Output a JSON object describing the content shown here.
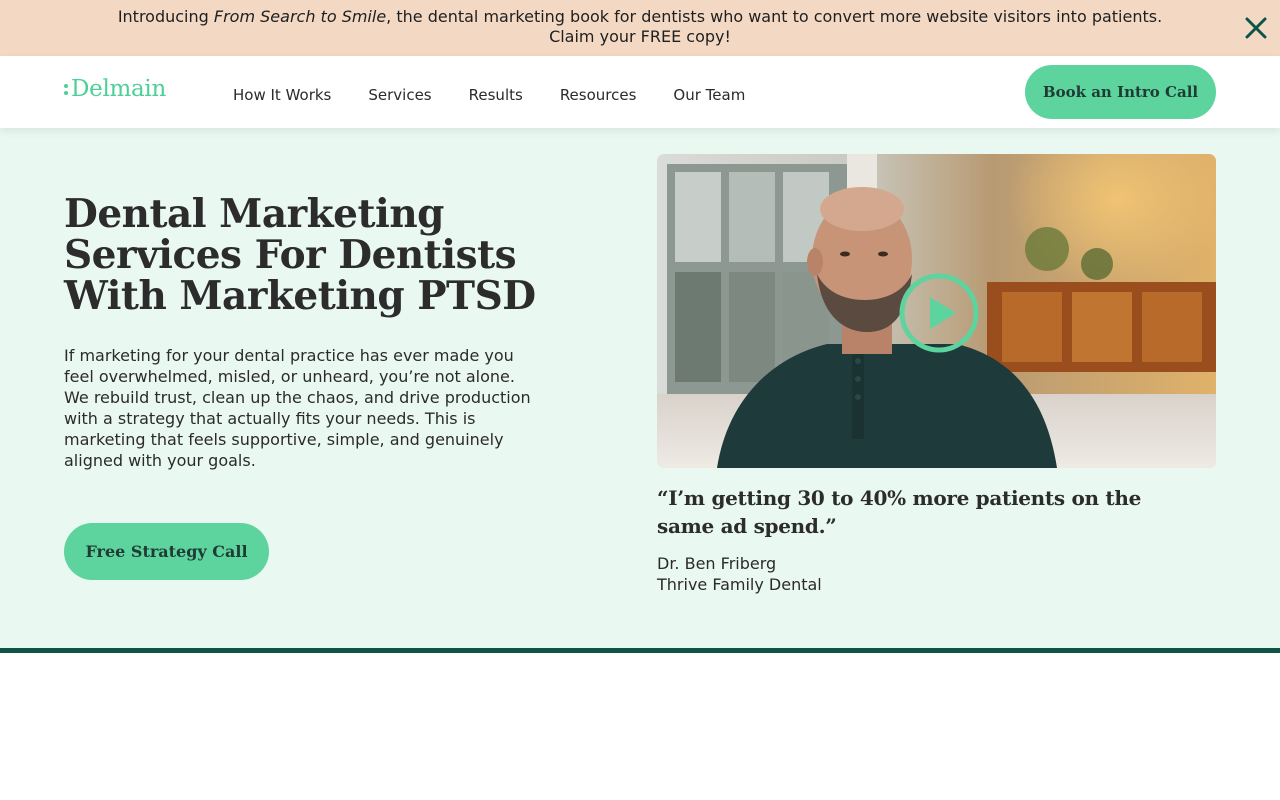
{
  "announcement": {
    "prefix": "Introducing ",
    "book_title": "From Search to Smile",
    "suffix": ", the dental marketing book for dentists who want to convert more website visitors into patients.",
    "line2": "Claim your FREE copy!",
    "close_icon": "close-icon"
  },
  "header": {
    "logo": "Delmain",
    "nav": [
      "How It Works",
      "Services",
      "Results",
      "Resources",
      "Our Team"
    ],
    "cta": "Book an Intro Call"
  },
  "hero": {
    "title": "Dental Marketing Services For Dentists With Marketing PTSD",
    "body": "If marketing for your dental practice has ever made you feel overwhelmed, misled, or unheard, you’re not alone. We rebuild trust, clean up the chaos, and drive production with a strategy that actually fits your needs. This is marketing that feels supportive, simple, and genuinely aligned with your goals.",
    "cta": "Free Strategy Call"
  },
  "testimonial": {
    "video_icon": "play-icon",
    "quote": "“I’m getting 30 to 40% more patients on the same ad spend.”",
    "name": "Dr. Ben Friberg",
    "practice": "Thrive Family Dental"
  },
  "colors": {
    "accent": "#5dd39e",
    "hero_bg": "#eaf8f2",
    "announcement_bg": "#f3d9c4",
    "divider": "#0e5446"
  }
}
